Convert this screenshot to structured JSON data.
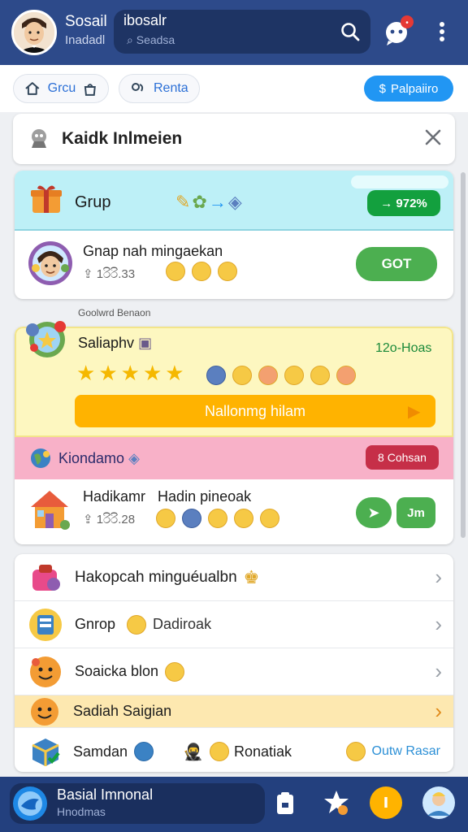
{
  "header": {
    "title": "Sosail",
    "subtitle": "Inadadl",
    "search_title": "ibosalr",
    "search_placeholder": "Seadsa"
  },
  "filters": {
    "chip1_label": "Grcu",
    "chip2_label": "Renta",
    "primary_label": "Palpaiiro"
  },
  "notice": {
    "title": "Kaidk Inlmeien"
  },
  "group_card": {
    "header_title": "Grup",
    "header_badge": "→ 972%",
    "row_title": "Gnap nah mingaekan",
    "row_meta": "1රිරි.33",
    "row_button": "GOT"
  },
  "section_label": "Goolwrd Benaon",
  "yellow_card": {
    "title": "Saliaphv",
    "right_text": "12o-Hoas",
    "progress_label": "Nallonmg hilam"
  },
  "pink_band": {
    "title": "Kiondamo",
    "badge": "8 Cohsan"
  },
  "second_row": {
    "title_a": "Hadikamr",
    "title_b": "Hadin pineoak",
    "meta": "1රිරි.28",
    "button": "Jm"
  },
  "list": {
    "item1": "Hakopcah minguéualbn",
    "item2_a": "Gnrop",
    "item2_b": "Dadiroak",
    "item3": "Soaicka blon",
    "item4": "Sadiah Saigian",
    "item5_a": "Samdan",
    "item5_b": "Ronatiak",
    "item5_link": "Outw Rasar"
  },
  "footer": {
    "now_title": "Basial Imnonal",
    "now_sub": "Hnodmas"
  },
  "colors": {
    "header_bg": "#2d4a8a",
    "accent_blue": "#2196f3",
    "green": "#4caf50",
    "orange": "#ffb300",
    "pink": "#f8b1c8",
    "cyan": "#bdf0f7",
    "yellow_panel": "#fdf7c0"
  }
}
